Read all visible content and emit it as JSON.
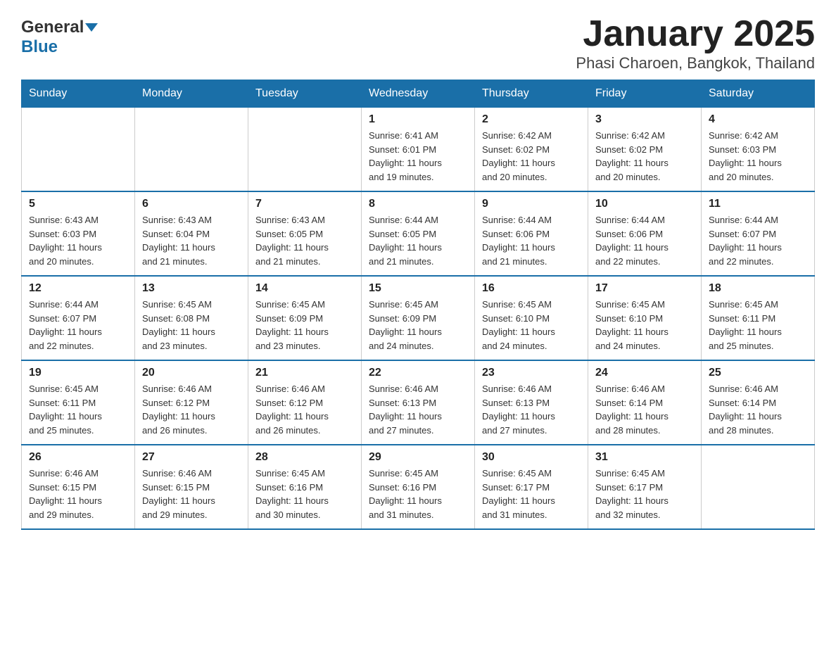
{
  "header": {
    "logo_general": "General",
    "logo_blue": "Blue",
    "title": "January 2025",
    "subtitle": "Phasi Charoen, Bangkok, Thailand"
  },
  "weekdays": [
    "Sunday",
    "Monday",
    "Tuesday",
    "Wednesday",
    "Thursday",
    "Friday",
    "Saturday"
  ],
  "weeks": [
    [
      {
        "day": "",
        "info": ""
      },
      {
        "day": "",
        "info": ""
      },
      {
        "day": "",
        "info": ""
      },
      {
        "day": "1",
        "info": "Sunrise: 6:41 AM\nSunset: 6:01 PM\nDaylight: 11 hours\nand 19 minutes."
      },
      {
        "day": "2",
        "info": "Sunrise: 6:42 AM\nSunset: 6:02 PM\nDaylight: 11 hours\nand 20 minutes."
      },
      {
        "day": "3",
        "info": "Sunrise: 6:42 AM\nSunset: 6:02 PM\nDaylight: 11 hours\nand 20 minutes."
      },
      {
        "day": "4",
        "info": "Sunrise: 6:42 AM\nSunset: 6:03 PM\nDaylight: 11 hours\nand 20 minutes."
      }
    ],
    [
      {
        "day": "5",
        "info": "Sunrise: 6:43 AM\nSunset: 6:03 PM\nDaylight: 11 hours\nand 20 minutes."
      },
      {
        "day": "6",
        "info": "Sunrise: 6:43 AM\nSunset: 6:04 PM\nDaylight: 11 hours\nand 21 minutes."
      },
      {
        "day": "7",
        "info": "Sunrise: 6:43 AM\nSunset: 6:05 PM\nDaylight: 11 hours\nand 21 minutes."
      },
      {
        "day": "8",
        "info": "Sunrise: 6:44 AM\nSunset: 6:05 PM\nDaylight: 11 hours\nand 21 minutes."
      },
      {
        "day": "9",
        "info": "Sunrise: 6:44 AM\nSunset: 6:06 PM\nDaylight: 11 hours\nand 21 minutes."
      },
      {
        "day": "10",
        "info": "Sunrise: 6:44 AM\nSunset: 6:06 PM\nDaylight: 11 hours\nand 22 minutes."
      },
      {
        "day": "11",
        "info": "Sunrise: 6:44 AM\nSunset: 6:07 PM\nDaylight: 11 hours\nand 22 minutes."
      }
    ],
    [
      {
        "day": "12",
        "info": "Sunrise: 6:44 AM\nSunset: 6:07 PM\nDaylight: 11 hours\nand 22 minutes."
      },
      {
        "day": "13",
        "info": "Sunrise: 6:45 AM\nSunset: 6:08 PM\nDaylight: 11 hours\nand 23 minutes."
      },
      {
        "day": "14",
        "info": "Sunrise: 6:45 AM\nSunset: 6:09 PM\nDaylight: 11 hours\nand 23 minutes."
      },
      {
        "day": "15",
        "info": "Sunrise: 6:45 AM\nSunset: 6:09 PM\nDaylight: 11 hours\nand 24 minutes."
      },
      {
        "day": "16",
        "info": "Sunrise: 6:45 AM\nSunset: 6:10 PM\nDaylight: 11 hours\nand 24 minutes."
      },
      {
        "day": "17",
        "info": "Sunrise: 6:45 AM\nSunset: 6:10 PM\nDaylight: 11 hours\nand 24 minutes."
      },
      {
        "day": "18",
        "info": "Sunrise: 6:45 AM\nSunset: 6:11 PM\nDaylight: 11 hours\nand 25 minutes."
      }
    ],
    [
      {
        "day": "19",
        "info": "Sunrise: 6:45 AM\nSunset: 6:11 PM\nDaylight: 11 hours\nand 25 minutes."
      },
      {
        "day": "20",
        "info": "Sunrise: 6:46 AM\nSunset: 6:12 PM\nDaylight: 11 hours\nand 26 minutes."
      },
      {
        "day": "21",
        "info": "Sunrise: 6:46 AM\nSunset: 6:12 PM\nDaylight: 11 hours\nand 26 minutes."
      },
      {
        "day": "22",
        "info": "Sunrise: 6:46 AM\nSunset: 6:13 PM\nDaylight: 11 hours\nand 27 minutes."
      },
      {
        "day": "23",
        "info": "Sunrise: 6:46 AM\nSunset: 6:13 PM\nDaylight: 11 hours\nand 27 minutes."
      },
      {
        "day": "24",
        "info": "Sunrise: 6:46 AM\nSunset: 6:14 PM\nDaylight: 11 hours\nand 28 minutes."
      },
      {
        "day": "25",
        "info": "Sunrise: 6:46 AM\nSunset: 6:14 PM\nDaylight: 11 hours\nand 28 minutes."
      }
    ],
    [
      {
        "day": "26",
        "info": "Sunrise: 6:46 AM\nSunset: 6:15 PM\nDaylight: 11 hours\nand 29 minutes."
      },
      {
        "day": "27",
        "info": "Sunrise: 6:46 AM\nSunset: 6:15 PM\nDaylight: 11 hours\nand 29 minutes."
      },
      {
        "day": "28",
        "info": "Sunrise: 6:45 AM\nSunset: 6:16 PM\nDaylight: 11 hours\nand 30 minutes."
      },
      {
        "day": "29",
        "info": "Sunrise: 6:45 AM\nSunset: 6:16 PM\nDaylight: 11 hours\nand 31 minutes."
      },
      {
        "day": "30",
        "info": "Sunrise: 6:45 AM\nSunset: 6:17 PM\nDaylight: 11 hours\nand 31 minutes."
      },
      {
        "day": "31",
        "info": "Sunrise: 6:45 AM\nSunset: 6:17 PM\nDaylight: 11 hours\nand 32 minutes."
      },
      {
        "day": "",
        "info": ""
      }
    ]
  ]
}
